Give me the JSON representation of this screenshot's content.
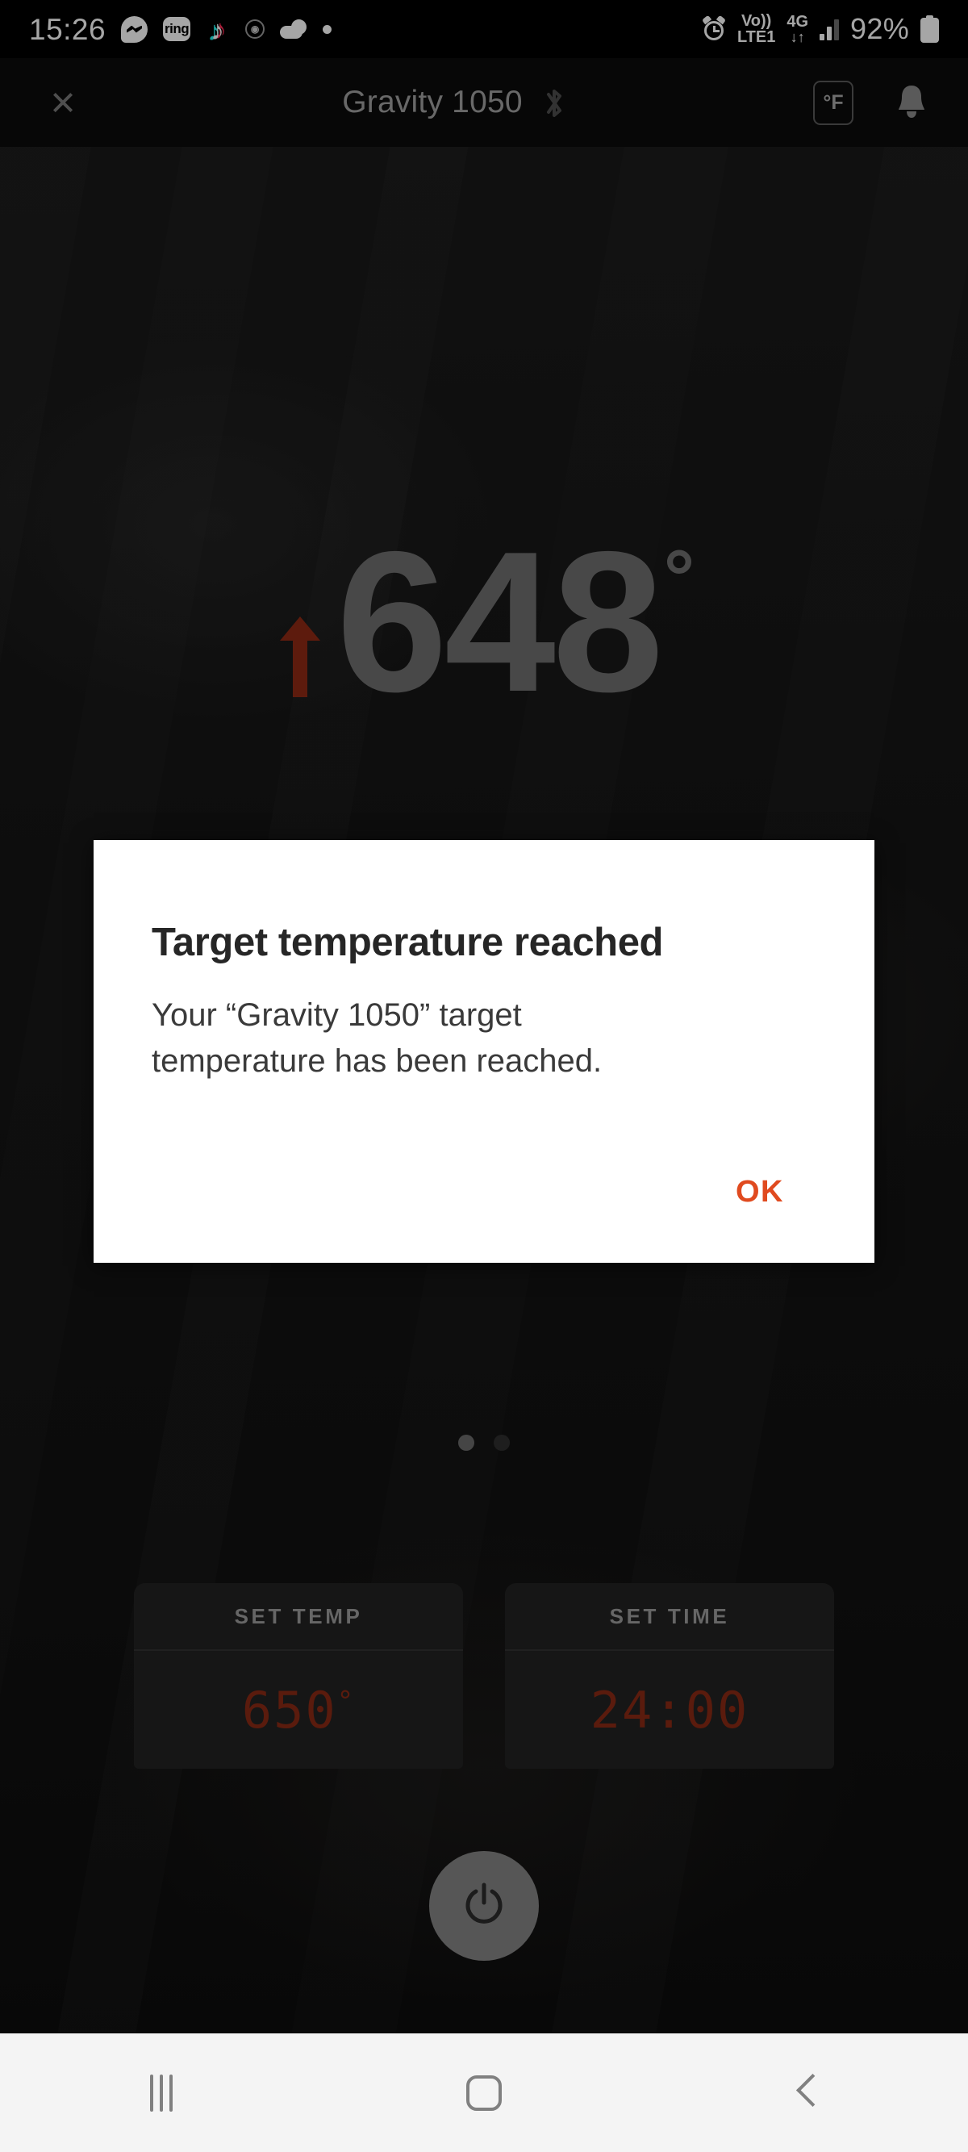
{
  "status_bar": {
    "time": "15:26",
    "notification_icons": [
      {
        "name": "messenger-icon",
        "label": "Messenger"
      },
      {
        "name": "ring-icon",
        "label": "ring"
      },
      {
        "name": "tiktok-icon",
        "label": "TikTok"
      },
      {
        "name": "circled-app-icon",
        "label": "⊕"
      },
      {
        "name": "weather-cloud-icon",
        "label": "Cloud"
      },
      {
        "name": "generic-dot-icon",
        "label": "•"
      }
    ],
    "alarm_icon": "alarm-clock-icon",
    "volte_top": "Vo))",
    "volte_bottom": "LTE1",
    "network_type": "4G",
    "data_arrows": "↓↑",
    "signal_icon": "signal-bars-icon",
    "battery_percent": "92%",
    "battery_icon": "battery-icon"
  },
  "header": {
    "close_icon": "×",
    "device_name": "Gravity 1050",
    "bluetooth_icon": "bluetooth-icon",
    "unit_label": "°F",
    "bell_icon": "notification-bell-icon"
  },
  "temperature": {
    "trend_icon": "arrow-up-icon",
    "trend_color": "#8f2a14",
    "value": "648",
    "degree_symbol": "°",
    "color": "#6f6f6f"
  },
  "dialog": {
    "title": "Target temperature reached",
    "body": "Your “Gravity 1050” target temperature has been reached.",
    "ok_label": "OK",
    "ok_color": "#e04a1f",
    "background": "#ffffff"
  },
  "page_dots": {
    "count": 2,
    "active_index": 0
  },
  "controls": [
    {
      "label": "SET TEMP",
      "value": "650",
      "suffix": "°",
      "value_color": "#8a2a14"
    },
    {
      "label": "SET TIME",
      "value": "24:00",
      "suffix": "",
      "value_color": "#8a2a14"
    }
  ],
  "power_button": {
    "icon": "power-icon",
    "color": "#858585"
  },
  "nav_bar": {
    "recents_icon": "recents-icon",
    "home_icon": "home-icon",
    "back_icon": "back-icon"
  }
}
